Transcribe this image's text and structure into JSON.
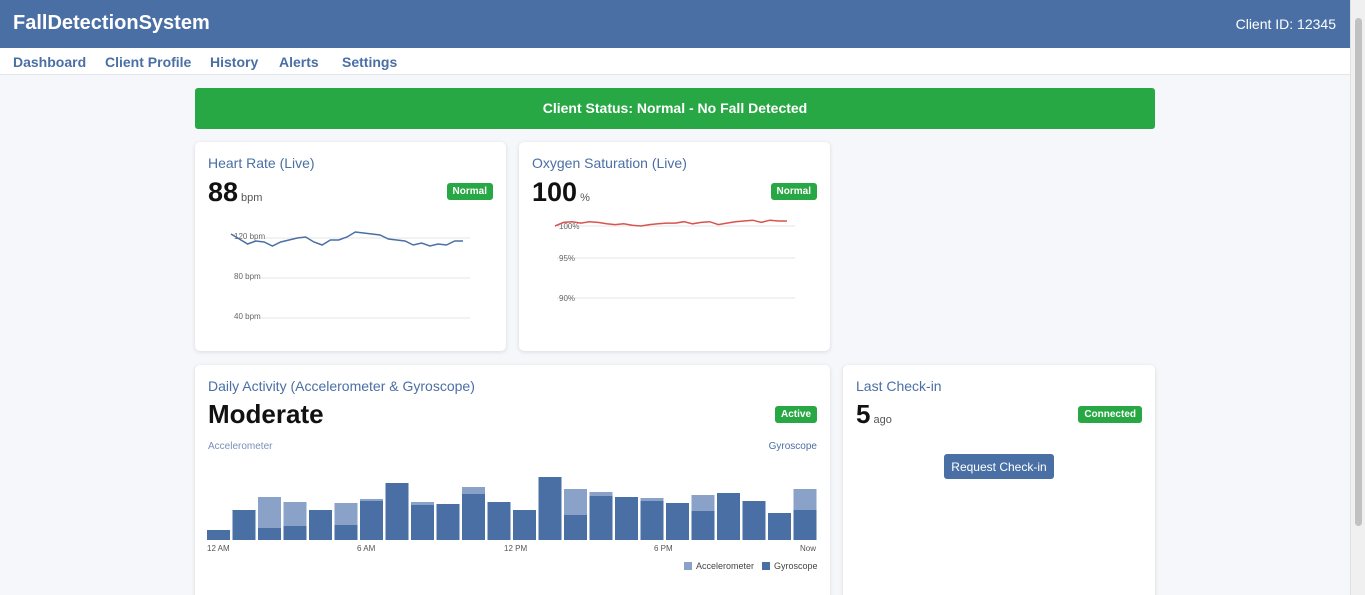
{
  "app": {
    "title": "FallDetectionSystem",
    "client_id": "Client ID: 12345"
  },
  "nav": [
    {
      "label": "Dashboard"
    },
    {
      "label": "Client Profile"
    },
    {
      "label": "History"
    },
    {
      "label": "Alerts"
    },
    {
      "label": "Settings"
    }
  ],
  "status_banner": "Client Status: Normal - No Fall Detected",
  "heart_rate": {
    "title": "Heart Rate (Live)",
    "value": "88",
    "unit": "bpm",
    "badge": "Normal",
    "y_ticks": [
      "120 bpm",
      "80 bpm",
      "40 bpm"
    ],
    "series": [
      124,
      119,
      114,
      117,
      116,
      112,
      116,
      118,
      120,
      121,
      116,
      113,
      118,
      118,
      121,
      126,
      125,
      124,
      123,
      119,
      118,
      117,
      113,
      115,
      112,
      114,
      113,
      117,
      117
    ]
  },
  "oxygen": {
    "title": "Oxygen Saturation (Live)",
    "value": "100",
    "unit": "%",
    "badge": "Normal",
    "y_ticks": [
      "100%",
      "95%",
      "90%"
    ],
    "series": [
      100.0,
      100.5,
      100.6,
      100.4,
      100.6,
      100.5,
      100.3,
      100.2,
      100.3,
      100.1,
      100.0,
      100.2,
      100.3,
      100.4,
      100.4,
      100.6,
      100.3,
      100.5,
      100.6,
      100.2,
      100.4,
      100.6,
      100.7,
      100.8,
      100.5,
      100.8,
      100.7,
      100.7
    ]
  },
  "activity": {
    "title": "Daily Activity (Accelerometer & Gyroscope)",
    "value": "Moderate",
    "badge": "Active",
    "left_label": "Accelerometer",
    "right_label": "Gyroscope",
    "x_ticks": [
      "12 AM",
      "6 AM",
      "12 PM",
      "6 PM",
      "Now"
    ],
    "legend": [
      "Accelerometer",
      "Gyroscope"
    ],
    "colors": {
      "accelerometer": "#8aa2c8",
      "gyroscope": "#4a6fa5"
    },
    "accelerometer": [
      10,
      30,
      43,
      38,
      30,
      37,
      41,
      57,
      38,
      36,
      53,
      38,
      30,
      63,
      51,
      48,
      43,
      42,
      37,
      45,
      47,
      39,
      27,
      51
    ],
    "gyroscope": [
      10,
      30,
      12,
      14,
      30,
      15,
      39,
      57,
      35,
      36,
      46,
      38,
      30,
      63,
      25,
      44,
      43,
      39,
      37,
      29,
      47,
      39,
      27,
      30
    ]
  },
  "checkin": {
    "title": "Last Check-in",
    "value": "5",
    "unit": "ago",
    "badge": "Connected",
    "button": "Request Check-in"
  }
}
